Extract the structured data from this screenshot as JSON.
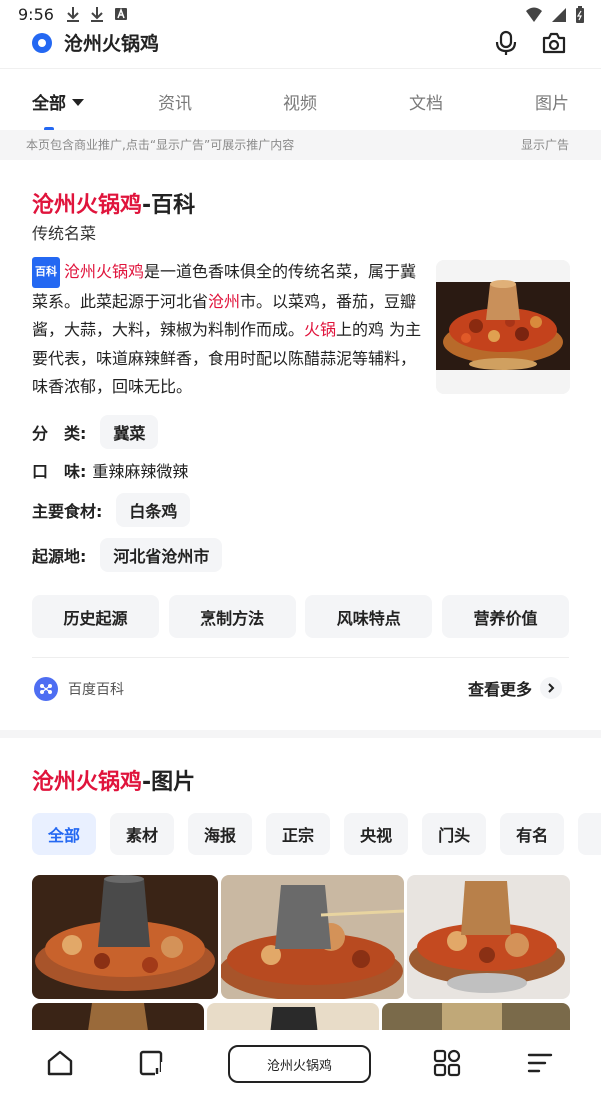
{
  "status_bar": {
    "time": "9:56"
  },
  "search": {
    "query": "沧州火锅鸡"
  },
  "tabs": [
    {
      "label": "全部",
      "active": true
    },
    {
      "label": "资讯"
    },
    {
      "label": "视频"
    },
    {
      "label": "文档"
    },
    {
      "label": "图片"
    }
  ],
  "ad_notice": {
    "text": "本页包含商业推广,点击“显示广告”可展示推广内容",
    "show_label": "显示广告"
  },
  "baike_card": {
    "title_red": "沧州火锅鸡",
    "title_rest": "-百科",
    "subtitle": "传统名菜",
    "badge": "百科",
    "desc": {
      "p1_red": "沧州火锅鸡",
      "p2": "是一道色香味俱全的传统名菜，属于冀菜系。此菜起源于河北省",
      "p3_red": "沧州",
      "p4": "市。以菜鸡，番茄，豆瓣酱，大蒜，大料，辣椒为料制作而成。",
      "p5_red": "火锅",
      "p6": "上的鸡 为主要代表，味道麻辣鲜香，食用时配以陈醋蒜泥等辅料，味香浓郁，回味无比。"
    },
    "info": {
      "category_label": "分　类:",
      "category_value": "冀菜",
      "taste_label": "口　味:",
      "taste_value": "重辣麻辣微辣",
      "ingredient_label": "主要食材:",
      "ingredient_value": "白条鸡",
      "origin_label": "起源地:",
      "origin_value": "河北省沧州市"
    },
    "buttons": [
      "历史起源",
      "烹制方法",
      "风味特点",
      "营养价值"
    ],
    "source": "百度百科",
    "more": "查看更多"
  },
  "image_card": {
    "title_red": "沧州火锅鸡",
    "title_rest": "-图片",
    "filters": [
      "全部",
      "素材",
      "海报",
      "正宗",
      "央视",
      "门头",
      "有名"
    ]
  },
  "bottom_bar": {
    "search_text": "沧州火锅鸡"
  },
  "colors": {
    "accent": "#2468f2",
    "highlight_red": "#e0143c"
  }
}
